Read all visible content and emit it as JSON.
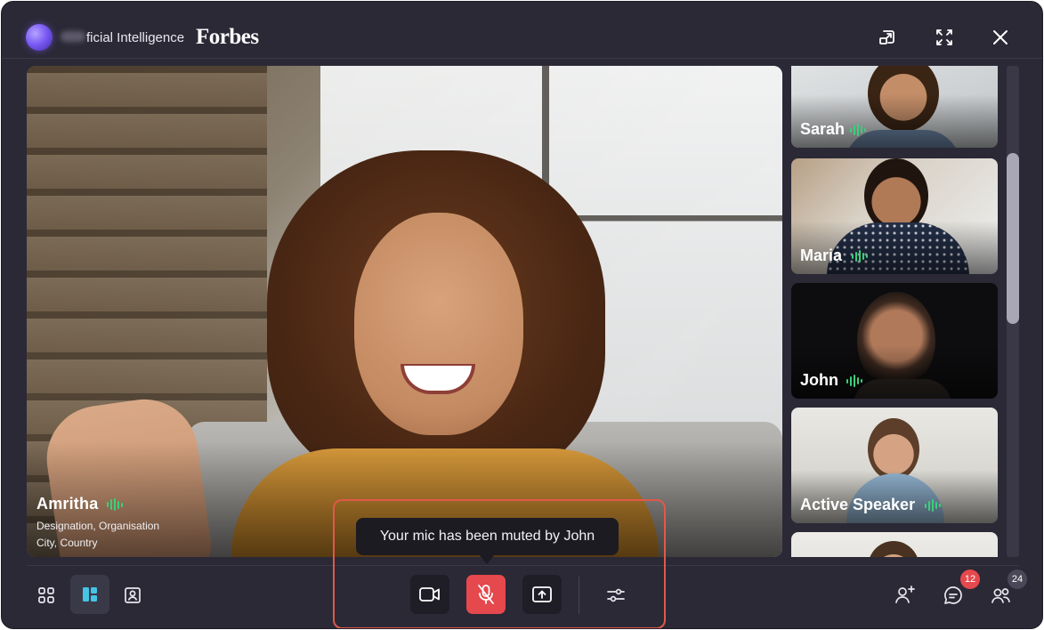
{
  "header": {
    "brand_text": "ficial Intelligence",
    "partner": "Forbes"
  },
  "main_speaker": {
    "name": "Amritha",
    "designation": "Designation, Organisation",
    "location": "City, Country"
  },
  "toast": {
    "text": "Your mic has been muted by John"
  },
  "participants": [
    {
      "name": "Sarah"
    },
    {
      "name": "Maria"
    },
    {
      "name": "John"
    },
    {
      "name": "Active Speaker"
    }
  ],
  "badges": {
    "chat_unread": "12",
    "participants_count": "24"
  },
  "colors": {
    "window_bg": "#2b2936",
    "mic_muted": "#e5484d",
    "highlight": "#e0594a",
    "audio_active": "#3ad07a",
    "badge_red": "#e5484d",
    "badge_gray": "#4a4858"
  },
  "icons": {
    "layout_grid": "grid-icon",
    "layout_spotlight": "spotlight-layout-icon",
    "layout_portrait": "portrait-icon",
    "camera": "video-camera-icon",
    "mic": "mic-off-icon",
    "share": "share-screen-icon",
    "settings": "sliders-icon",
    "add_person": "add-person-icon",
    "chat": "chat-icon",
    "people": "participants-icon",
    "popout": "pop-out-icon",
    "fullscreen": "fullscreen-icon",
    "close": "close-icon"
  }
}
